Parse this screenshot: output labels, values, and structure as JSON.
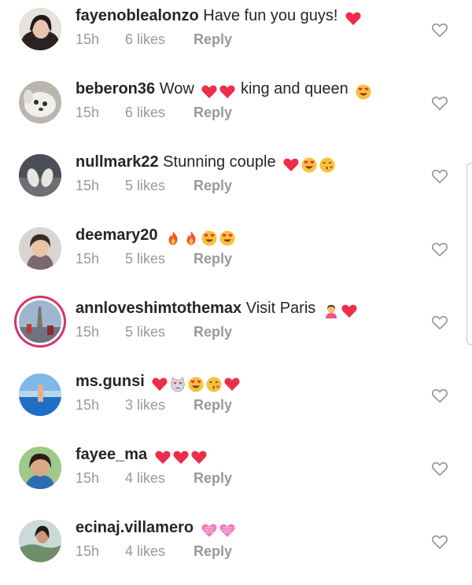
{
  "comments": [
    {
      "username": "fayenoblealonzo",
      "text": "Have fun you guys!",
      "emojis": [
        "red-heart"
      ],
      "time": "15h",
      "likes": "6 likes",
      "reply": "Reply"
    },
    {
      "username": "beberon36",
      "text": "Wow",
      "emojis": [
        "red-heart",
        "red-heart"
      ],
      "text2": "king and queen",
      "emojis2": [
        "heart-eyes"
      ],
      "time": "15h",
      "likes": "6 likes",
      "reply": "Reply"
    },
    {
      "username": "nullmark22",
      "text": "Stunning couple",
      "emojis": [
        "red-heart",
        "heart-eyes",
        "kissing-face"
      ],
      "time": "15h",
      "likes": "5 likes",
      "reply": "Reply"
    },
    {
      "username": "deemary20",
      "text": "",
      "emojis": [
        "fire",
        "fire",
        "heart-eyes",
        "heart-eyes"
      ],
      "time": "15h",
      "likes": "5 likes",
      "reply": "Reply"
    },
    {
      "username": "annloveshimtothemax",
      "text": "Visit Paris",
      "emojis": [
        "person-gesturing",
        "red-heart"
      ],
      "time": "15h",
      "likes": "5 likes",
      "reply": "Reply",
      "story_ring": true
    },
    {
      "username": "ms.gunsi",
      "text": "",
      "emojis": [
        "red-heart",
        "cat-heart-eyes",
        "heart-eyes",
        "kissing-face",
        "red-heart"
      ],
      "time": "15h",
      "likes": "3 likes",
      "reply": "Reply"
    },
    {
      "username": "fayee_ma",
      "text": "",
      "emojis": [
        "red-heart",
        "red-heart",
        "red-heart"
      ],
      "time": "15h",
      "likes": "4 likes",
      "reply": "Reply"
    },
    {
      "username": "ecinaj.villamero",
      "text": "",
      "emojis": [
        "pink-heart",
        "pink-heart"
      ],
      "time": "15h",
      "likes": "4 likes",
      "reply": "Reply"
    }
  ],
  "icons": {
    "like": "heart-outline-icon"
  },
  "colors": {
    "meta_text": "#999999",
    "username_text": "#262626",
    "heart_red": "#ed2d4a",
    "story_ring": "#d6336c"
  }
}
